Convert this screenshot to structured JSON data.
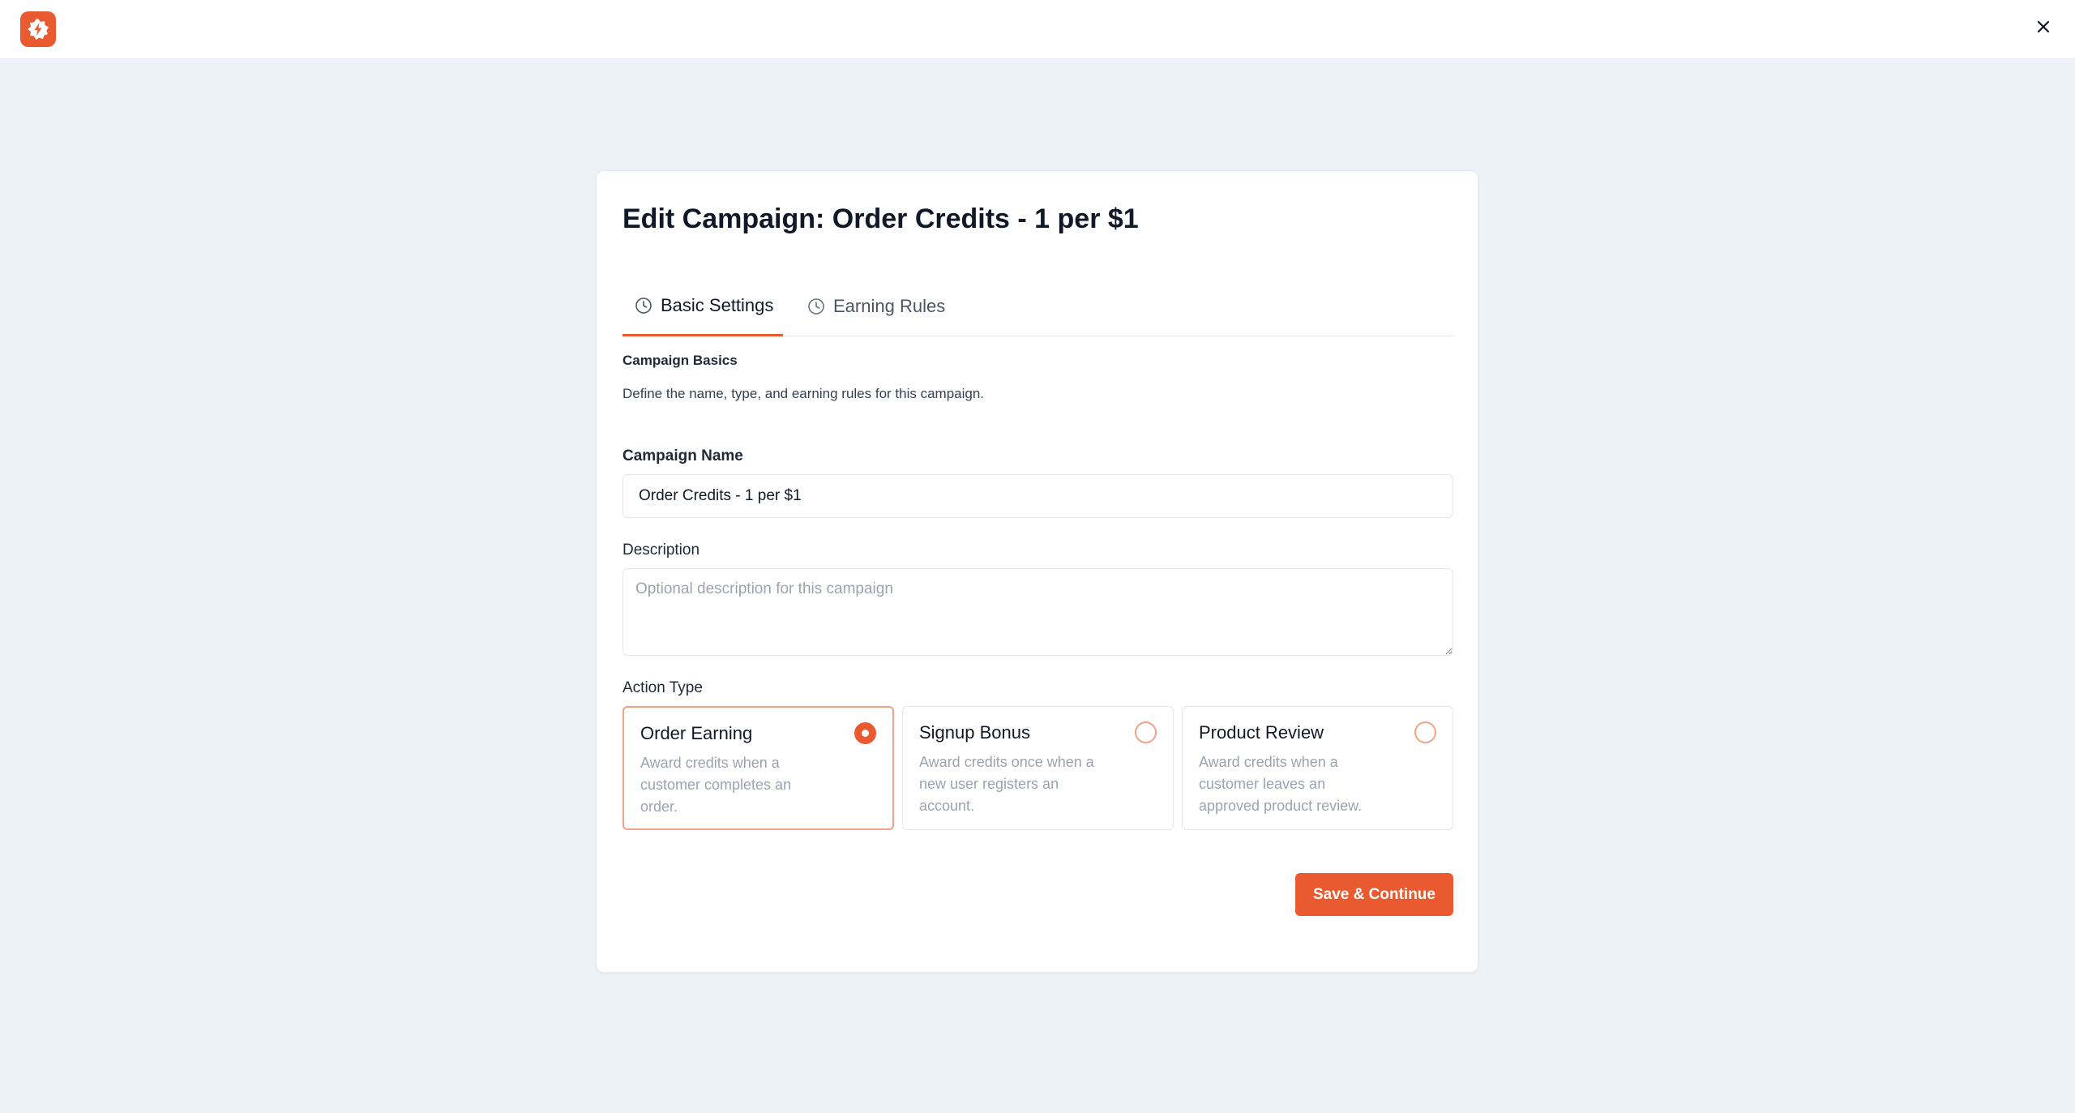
{
  "header": {
    "logo_icon": "logo-badge-icon",
    "close_icon": "close-icon"
  },
  "colors": {
    "accent": "#ea5a30",
    "background": "#edf1f8"
  },
  "card": {
    "title": "Edit Campaign: Order Credits - 1 per $1",
    "tabs": [
      {
        "label": "Basic Settings",
        "icon": "clock-icon",
        "active": true
      },
      {
        "label": "Earning Rules",
        "icon": "clock-icon",
        "active": false
      }
    ],
    "section": {
      "title": "Campaign Basics",
      "description": "Define the name, type, and earning rules for this campaign."
    },
    "campaign_name": {
      "label": "Campaign Name",
      "value": "Order Credits - 1 per $1"
    },
    "description": {
      "label": "Description",
      "placeholder": "Optional description for this campaign",
      "value": ""
    },
    "action_type": {
      "label": "Action Type",
      "options": [
        {
          "title": "Order Earning",
          "description": "Award credits when a customer completes an order.",
          "selected": true
        },
        {
          "title": "Signup Bonus",
          "description": "Award credits once when a new user registers an account.",
          "selected": false
        },
        {
          "title": "Product Review",
          "description": "Award credits when a customer leaves an approved product review.",
          "selected": false
        }
      ]
    },
    "save_label": "Save & Continue"
  }
}
